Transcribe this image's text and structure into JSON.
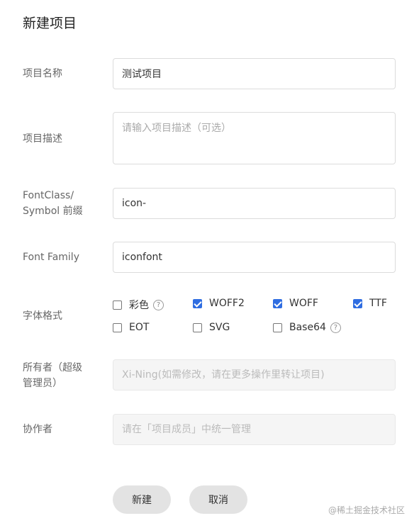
{
  "dialog": {
    "title": "新建项目"
  },
  "form": {
    "name": {
      "label": "项目名称",
      "value": "测试项目"
    },
    "description": {
      "label": "项目描述",
      "placeholder": "请输入项目描述（可选）"
    },
    "prefix": {
      "label_line1": "FontClass/",
      "label_line2": "Symbol 前缀",
      "value": "icon-"
    },
    "font_family": {
      "label": "Font Family",
      "value": "iconfont"
    },
    "formats": {
      "label": "字体格式",
      "options": [
        {
          "label": "彩色",
          "checked": false,
          "help_icon": "question-circle-icon"
        },
        {
          "label": "WOFF2",
          "checked": true
        },
        {
          "label": "WOFF",
          "checked": true
        },
        {
          "label": "TTF",
          "checked": true
        },
        {
          "label": "EOT",
          "checked": false
        },
        {
          "label": "SVG",
          "checked": false
        },
        {
          "label": "Base64",
          "checked": false,
          "help_icon": "question-circle-icon"
        }
      ],
      "help_glyph": "?"
    },
    "owner": {
      "label_line1": "所有者（超级",
      "label_line2": "管理员）",
      "placeholder": "Xi-Ning(如需修改，请在更多操作里转让项目)"
    },
    "collaborators": {
      "label": "协作者",
      "placeholder": "请在「项目成员」中统一管理"
    }
  },
  "actions": {
    "create_label": "新建",
    "cancel_label": "取消"
  },
  "watermark": "@稀土掘金技术社区",
  "colors": {
    "checkbox_checked": "#2f6de1",
    "button_bg": "#e3e3e3"
  }
}
